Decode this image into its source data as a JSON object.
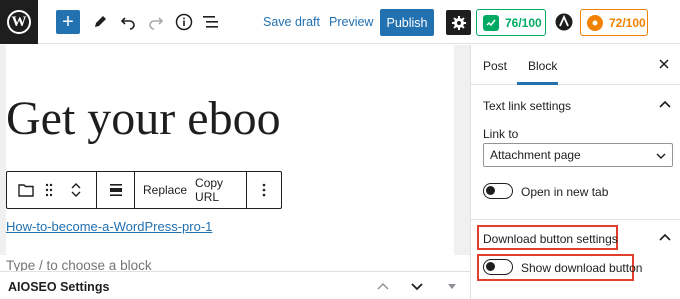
{
  "topbar": {
    "logo_letter": "W",
    "save_draft": "Save draft",
    "preview": "Preview",
    "publish": "Publish",
    "score_green": "76/100",
    "score_orange": "72/100"
  },
  "editor": {
    "title_fragment": "Get your eboo",
    "block_toolbar": {
      "replace": "Replace",
      "copy_url": "Copy URL"
    },
    "file_link": "How-to-become-a-WordPress-pro-1",
    "placeholder": "Type / to choose a block"
  },
  "bottom": {
    "aioseo_label": "AIOSEO Settings"
  },
  "sidebar": {
    "tabs": [
      "Post",
      "Block"
    ],
    "active_tab": "Block",
    "text_link_settings": "Text link settings",
    "link_to_label": "Link to",
    "link_to_value": "Attachment page",
    "open_new_tab": "Open in new tab",
    "download_button_settings": "Download button settings",
    "show_download_button": "Show download button"
  },
  "colors": {
    "accent": "#2271b1",
    "score_green": "#00aa63",
    "score_orange": "#f18200",
    "highlight": "#e2402e"
  }
}
